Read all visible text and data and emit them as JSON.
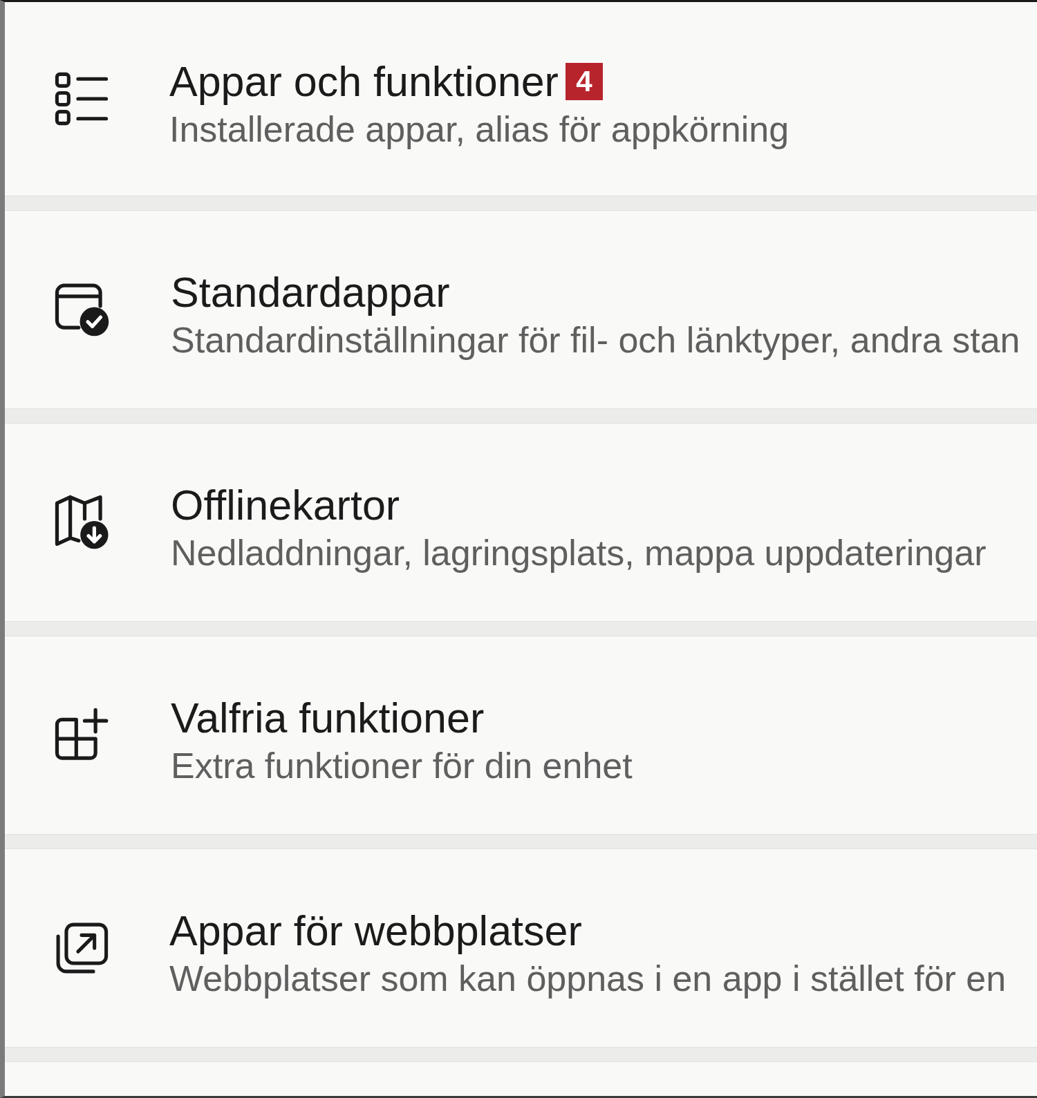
{
  "items": [
    {
      "title": "Appar och funktioner",
      "badge": "4",
      "description": "Installerade appar, alias för appkörning"
    },
    {
      "title": "Standardappar",
      "description": "Standardinställningar för fil- och länktyper, andra stan"
    },
    {
      "title": "Offlinekartor",
      "description": "Nedladdningar, lagringsplats, mappa uppdateringar"
    },
    {
      "title": "Valfria funktioner",
      "description": "Extra funktioner för din enhet"
    },
    {
      "title": "Appar för webbplatser",
      "description": "Webbplatser som kan öppnas i en app i stället för en"
    }
  ]
}
